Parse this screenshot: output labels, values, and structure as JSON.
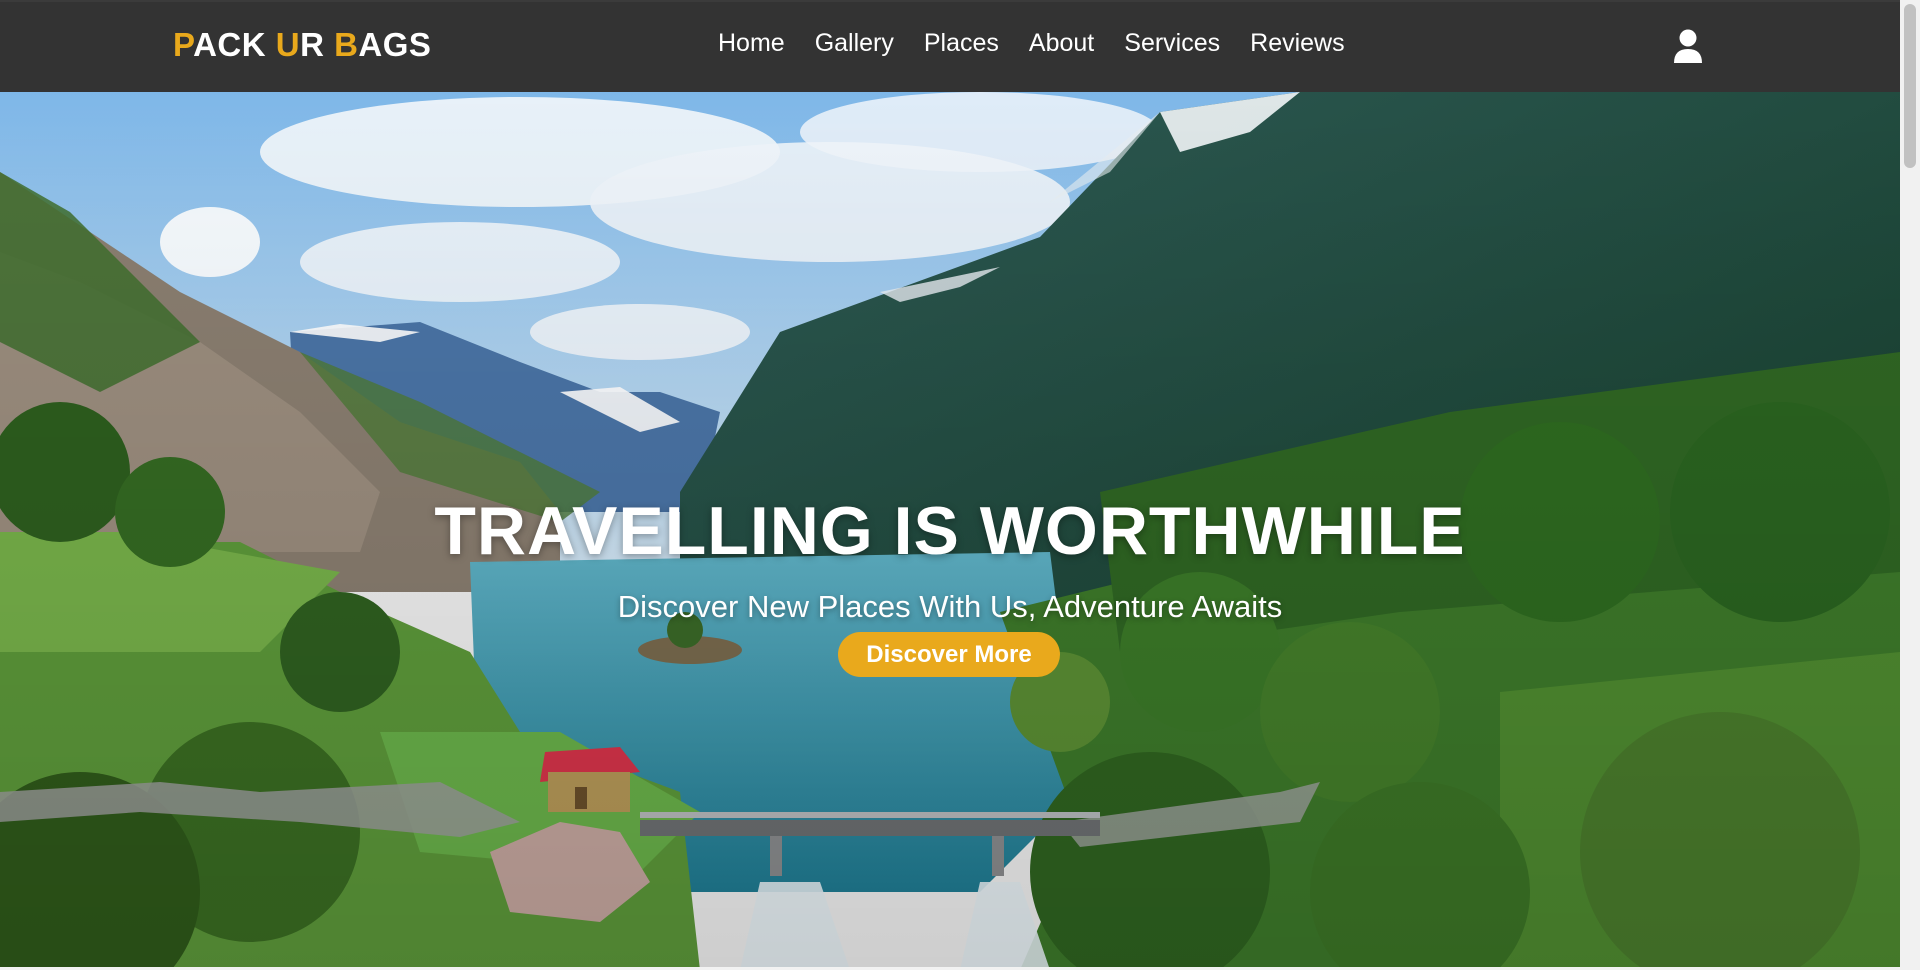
{
  "brand": {
    "parts": [
      {
        "text": "P",
        "accent": true
      },
      {
        "text": "ACK ",
        "accent": false
      },
      {
        "text": "U",
        "accent": true
      },
      {
        "text": "R ",
        "accent": false
      },
      {
        "text": "B",
        "accent": true
      },
      {
        "text": "AGS",
        "accent": false
      }
    ]
  },
  "nav": {
    "links": [
      "Home",
      "Gallery",
      "Places",
      "About",
      "Services",
      "Reviews"
    ],
    "user_icon": "user-icon"
  },
  "hero": {
    "title": "TRAVELLING IS WORTHWHILE",
    "subtitle": "Discover New Places With Us, Adventure Awaits",
    "cta_label": "Discover More"
  },
  "colors": {
    "navbar_bg": "#333333",
    "accent": "#e9a91c",
    "text": "#ffffff"
  }
}
